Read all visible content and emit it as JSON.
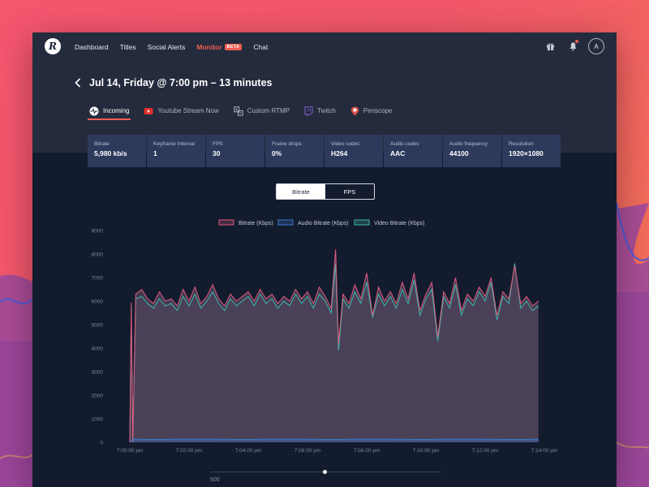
{
  "nav": {
    "logo_letter": "R",
    "items": [
      {
        "label": "Dashboard"
      },
      {
        "label": "Titles"
      },
      {
        "label": "Social Alerts"
      },
      {
        "label": "Monitor",
        "badge": "BETA"
      },
      {
        "label": "Chat"
      }
    ],
    "active_item": "Monitor",
    "avatar_letter": "A",
    "icons": [
      "gift-icon",
      "bell-icon"
    ]
  },
  "page": {
    "title": "Jul 14, Friday @ 7:00 pm – 13 minutes"
  },
  "tabs": [
    {
      "label": "Incoming",
      "icon": "pulse-icon",
      "active": true
    },
    {
      "label": "Youtube Stream Now",
      "icon": "youtube-icon"
    },
    {
      "label": "Custom RTMP",
      "icon": "rtmp-icon"
    },
    {
      "label": "Twitch",
      "icon": "twitch-icon"
    },
    {
      "label": "Periscope",
      "icon": "periscope-icon"
    }
  ],
  "stats": [
    {
      "label": "Bitrate",
      "value": "5,980 kb/s"
    },
    {
      "label": "Keyframe Interval",
      "value": "1"
    },
    {
      "label": "FPS",
      "value": "30"
    },
    {
      "label": "Frame drops",
      "value": "0%"
    },
    {
      "label": "Video codec",
      "value": "H264"
    },
    {
      "label": "Audio codec",
      "value": "AAC"
    },
    {
      "label": "Audio frequency",
      "value": "44100"
    },
    {
      "label": "Resolution",
      "value": "1920×1080"
    }
  ],
  "toggle": {
    "options": [
      "Bitrate",
      "FPS"
    ],
    "selected": "Bitrate"
  },
  "chart_data": {
    "type": "area",
    "legend": [
      "Bitrate (Kbps)",
      "Audio Bitrate (Kbps)",
      "Video Bitrate (Kbps)"
    ],
    "legend_placement": "top-center",
    "series_colors": [
      "#e0587a",
      "#3b78c8",
      "#3fb7ae"
    ],
    "y_ticks": [
      "9000",
      "8000",
      "7000",
      "6000",
      "5000",
      "4000",
      "3000",
      "2000",
      "1000",
      "0"
    ],
    "ylim": [
      0,
      9000
    ],
    "x_ticks": [
      "7:00:00 pm",
      "7:02:00 pm",
      "7:04:00 pm",
      "7:06:00 pm",
      "7:08:00 pm",
      "7:10:00 pm",
      "7:12:00 pm",
      "7:14:00 pm"
    ],
    "xlim_minutes": [
      0,
      14
    ],
    "series": [
      {
        "name": "Bitrate (Kbps)",
        "points": [
          [
            0.0,
            0
          ],
          [
            0.05,
            5950
          ],
          [
            0.1,
            0
          ],
          [
            0.2,
            6300
          ],
          [
            0.4,
            6500
          ],
          [
            0.6,
            6100
          ],
          [
            0.8,
            5900
          ],
          [
            1.0,
            6400
          ],
          [
            1.2,
            6000
          ],
          [
            1.4,
            6100
          ],
          [
            1.6,
            5800
          ],
          [
            1.8,
            6500
          ],
          [
            2.0,
            6000
          ],
          [
            2.2,
            6600
          ],
          [
            2.4,
            5900
          ],
          [
            2.6,
            6200
          ],
          [
            2.8,
            6700
          ],
          [
            3.0,
            6100
          ],
          [
            3.2,
            5800
          ],
          [
            3.4,
            6300
          ],
          [
            3.6,
            6000
          ],
          [
            3.8,
            6200
          ],
          [
            4.0,
            6400
          ],
          [
            4.2,
            6000
          ],
          [
            4.4,
            6500
          ],
          [
            4.6,
            6100
          ],
          [
            4.8,
            6300
          ],
          [
            5.0,
            5900
          ],
          [
            5.2,
            6200
          ],
          [
            5.4,
            6000
          ],
          [
            5.6,
            6500
          ],
          [
            5.8,
            6100
          ],
          [
            6.0,
            6400
          ],
          [
            6.2,
            5900
          ],
          [
            6.4,
            6600
          ],
          [
            6.6,
            6200
          ],
          [
            6.8,
            5700
          ],
          [
            6.95,
            8200
          ],
          [
            7.05,
            4200
          ],
          [
            7.2,
            6300
          ],
          [
            7.4,
            5900
          ],
          [
            7.6,
            6700
          ],
          [
            7.8,
            6100
          ],
          [
            8.0,
            7200
          ],
          [
            8.2,
            5400
          ],
          [
            8.4,
            6600
          ],
          [
            8.6,
            6000
          ],
          [
            8.8,
            6400
          ],
          [
            9.0,
            5900
          ],
          [
            9.2,
            6800
          ],
          [
            9.4,
            6100
          ],
          [
            9.6,
            7200
          ],
          [
            9.8,
            5600
          ],
          [
            10.0,
            6300
          ],
          [
            10.2,
            6800
          ],
          [
            10.4,
            4500
          ],
          [
            10.6,
            6400
          ],
          [
            10.8,
            5900
          ],
          [
            11.0,
            7000
          ],
          [
            11.2,
            5600
          ],
          [
            11.4,
            6300
          ],
          [
            11.6,
            6000
          ],
          [
            11.8,
            6600
          ],
          [
            12.0,
            6200
          ],
          [
            12.2,
            7000
          ],
          [
            12.4,
            5400
          ],
          [
            12.6,
            6400
          ],
          [
            12.8,
            6100
          ],
          [
            13.0,
            7500
          ],
          [
            13.2,
            5900
          ],
          [
            13.4,
            6200
          ],
          [
            13.6,
            5800
          ],
          [
            13.8,
            6000
          ]
        ]
      },
      {
        "name": "Audio Bitrate (Kbps)",
        "points": [
          [
            0.0,
            0
          ],
          [
            0.1,
            130
          ],
          [
            1.0,
            120
          ],
          [
            2.0,
            140
          ],
          [
            3.0,
            130
          ],
          [
            4.0,
            120
          ],
          [
            5.0,
            140
          ],
          [
            6.0,
            130
          ],
          [
            7.0,
            120
          ],
          [
            8.0,
            140
          ],
          [
            9.0,
            130
          ],
          [
            10.0,
            120
          ],
          [
            11.0,
            140
          ],
          [
            12.0,
            130
          ],
          [
            13.0,
            120
          ],
          [
            13.8,
            130
          ]
        ]
      },
      {
        "name": "Video Bitrate (Kbps)",
        "points": [
          [
            0.0,
            0
          ],
          [
            0.05,
            5800
          ],
          [
            0.1,
            0
          ],
          [
            0.2,
            6100
          ],
          [
            0.4,
            6200
          ],
          [
            0.6,
            5900
          ],
          [
            0.8,
            5700
          ],
          [
            1.0,
            6100
          ],
          [
            1.2,
            5800
          ],
          [
            1.4,
            5900
          ],
          [
            1.6,
            5600
          ],
          [
            1.8,
            6200
          ],
          [
            2.0,
            5800
          ],
          [
            2.2,
            6300
          ],
          [
            2.4,
            5700
          ],
          [
            2.6,
            6000
          ],
          [
            2.8,
            6400
          ],
          [
            3.0,
            5900
          ],
          [
            3.2,
            5600
          ],
          [
            3.4,
            6100
          ],
          [
            3.6,
            5800
          ],
          [
            3.8,
            6000
          ],
          [
            4.0,
            6200
          ],
          [
            4.2,
            5800
          ],
          [
            4.4,
            6300
          ],
          [
            4.6,
            5900
          ],
          [
            4.8,
            6100
          ],
          [
            5.0,
            5700
          ],
          [
            5.2,
            6000
          ],
          [
            5.4,
            5800
          ],
          [
            5.6,
            6300
          ],
          [
            5.8,
            5900
          ],
          [
            6.0,
            6200
          ],
          [
            6.2,
            5700
          ],
          [
            6.4,
            6300
          ],
          [
            6.6,
            6000
          ],
          [
            6.8,
            5500
          ],
          [
            6.95,
            7600
          ],
          [
            7.05,
            3900
          ],
          [
            7.2,
            6100
          ],
          [
            7.4,
            5700
          ],
          [
            7.6,
            6400
          ],
          [
            7.8,
            5900
          ],
          [
            8.0,
            6800
          ],
          [
            8.2,
            5300
          ],
          [
            8.4,
            6300
          ],
          [
            8.6,
            5800
          ],
          [
            8.8,
            6200
          ],
          [
            9.0,
            5700
          ],
          [
            9.2,
            6500
          ],
          [
            9.4,
            5900
          ],
          [
            9.6,
            6900
          ],
          [
            9.8,
            5400
          ],
          [
            10.0,
            6100
          ],
          [
            10.2,
            6500
          ],
          [
            10.4,
            4300
          ],
          [
            10.6,
            6200
          ],
          [
            10.8,
            5700
          ],
          [
            11.0,
            6700
          ],
          [
            11.2,
            5400
          ],
          [
            11.4,
            6100
          ],
          [
            11.6,
            5800
          ],
          [
            11.8,
            6400
          ],
          [
            12.0,
            6000
          ],
          [
            12.2,
            6800
          ],
          [
            12.4,
            5200
          ],
          [
            12.6,
            6200
          ],
          [
            12.8,
            5900
          ],
          [
            13.0,
            7600
          ],
          [
            13.2,
            5700
          ],
          [
            13.4,
            6000
          ],
          [
            13.6,
            5600
          ],
          [
            13.8,
            5800
          ]
        ]
      }
    ]
  },
  "slider": {
    "value_label": "500",
    "position_fraction": 0.5
  }
}
